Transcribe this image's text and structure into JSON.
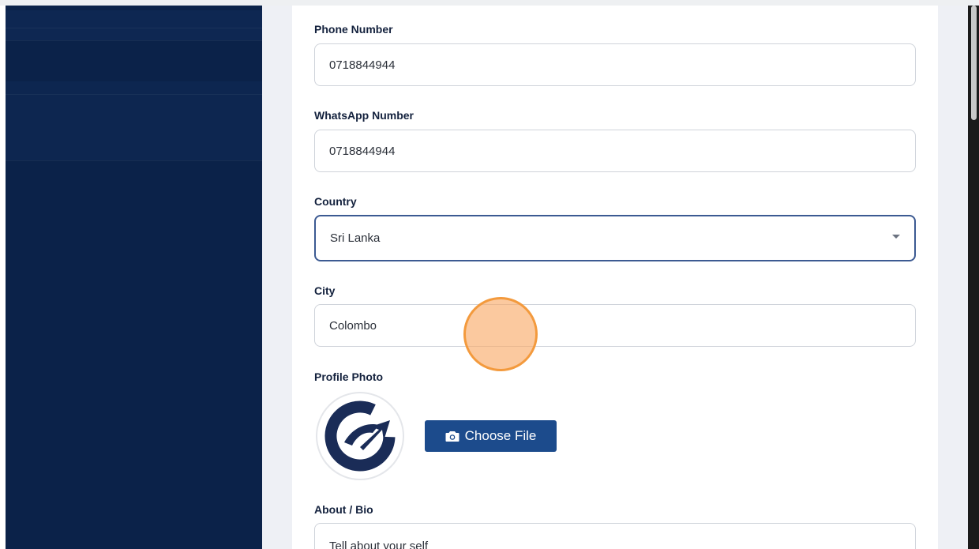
{
  "form": {
    "phone": {
      "label": "Phone Number",
      "value": "0718844944"
    },
    "whatsapp": {
      "label": "WhatsApp Number",
      "value": "0718844944"
    },
    "country": {
      "label": "Country",
      "value": "Sri Lanka"
    },
    "city": {
      "label": "City",
      "value": "Colombo"
    },
    "profile_photo": {
      "label": "Profile Photo",
      "button_label": "Choose File"
    },
    "bio": {
      "label": "About / Bio",
      "placeholder": "Tell about your self"
    }
  },
  "icons": {
    "camera": "camera-icon",
    "dropdown": "chevron-down-icon",
    "avatar_logo": "brand-logo-icon"
  },
  "colors": {
    "sidebar": "#0b2249",
    "primary_button": "#1c4b8c",
    "focus_border": "#3c5a92",
    "logo": "#1a2c57",
    "click_marker": "#f39a3d"
  }
}
